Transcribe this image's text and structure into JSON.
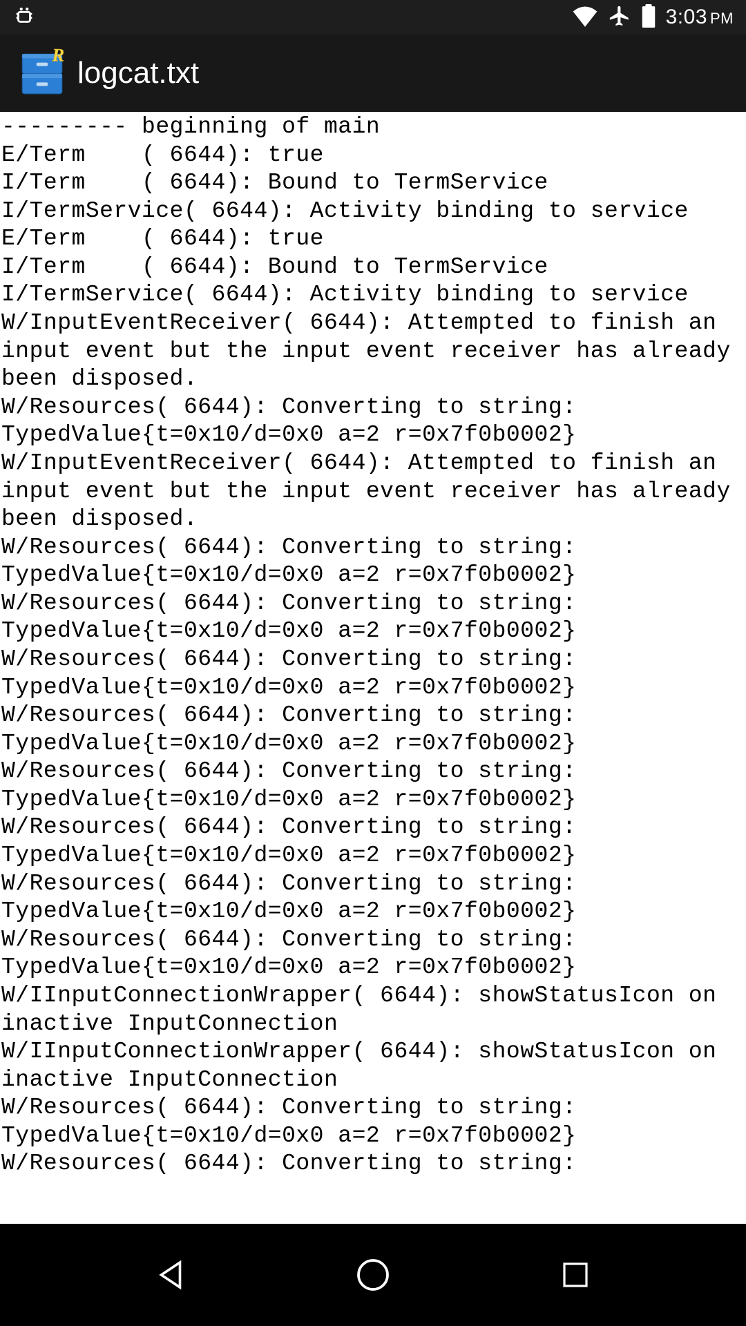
{
  "status_bar": {
    "time": "3:03",
    "ampm": "PM"
  },
  "app_bar": {
    "title": "logcat.txt"
  },
  "log_lines": [
    "--------- beginning of main",
    "E/Term    ( 6644): true",
    "I/Term    ( 6644): Bound to TermService",
    "I/TermService( 6644): Activity binding to service",
    "E/Term    ( 6644): true",
    "I/Term    ( 6644): Bound to TermService",
    "I/TermService( 6644): Activity binding to service",
    "W/InputEventReceiver( 6644): Attempted to finish an input event but the input event receiver has already been disposed.",
    "W/Resources( 6644): Converting to string: TypedValue{t=0x10/d=0x0 a=2 r=0x7f0b0002}",
    "W/InputEventReceiver( 6644): Attempted to finish an input event but the input event receiver has already been disposed.",
    "W/Resources( 6644): Converting to string: TypedValue{t=0x10/d=0x0 a=2 r=0x7f0b0002}",
    "W/Resources( 6644): Converting to string: TypedValue{t=0x10/d=0x0 a=2 r=0x7f0b0002}",
    "W/Resources( 6644): Converting to string: TypedValue{t=0x10/d=0x0 a=2 r=0x7f0b0002}",
    "W/Resources( 6644): Converting to string: TypedValue{t=0x10/d=0x0 a=2 r=0x7f0b0002}",
    "W/Resources( 6644): Converting to string: TypedValue{t=0x10/d=0x0 a=2 r=0x7f0b0002}",
    "W/Resources( 6644): Converting to string: TypedValue{t=0x10/d=0x0 a=2 r=0x7f0b0002}",
    "W/Resources( 6644): Converting to string: TypedValue{t=0x10/d=0x0 a=2 r=0x7f0b0002}",
    "W/Resources( 6644): Converting to string: TypedValue{t=0x10/d=0x0 a=2 r=0x7f0b0002}",
    "W/IInputConnectionWrapper( 6644): showStatusIcon on inactive InputConnection",
    "W/IInputConnectionWrapper( 6644): showStatusIcon on inactive InputConnection",
    "W/Resources( 6644): Converting to string: TypedValue{t=0x10/d=0x0 a=2 r=0x7f0b0002}",
    "W/Resources( 6644): Converting to string:"
  ]
}
